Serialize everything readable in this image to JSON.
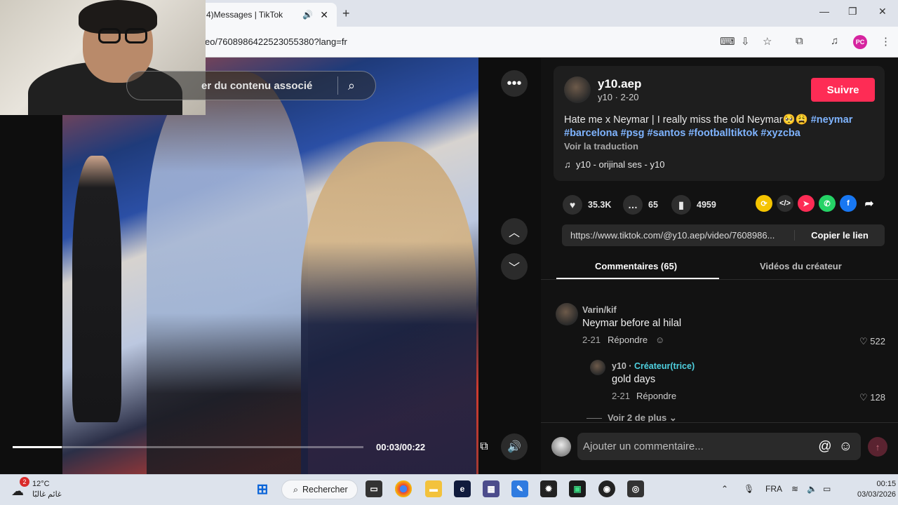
{
  "browser": {
    "tab_title": "4)Messages | TikTok",
    "tab_close": "✕",
    "new_tab": "+",
    "url": "eo/7608986422523055380?lang=fr",
    "profile_initials": "PC",
    "window_controls": [
      "—",
      "❐",
      "✕"
    ]
  },
  "video": {
    "search_placeholder": "er du contenu associé",
    "time": "00:03/00:22",
    "progress_percent": 14
  },
  "post": {
    "username": "y10.aep",
    "subline": "y10 · 2-20",
    "follow_label": "Suivre",
    "description_text": "Hate me x Neymar | I really miss the old Neymar🥺😩 ",
    "hashtags_line1": "#neymar",
    "hashtags_line2": "#barcelona #psg #santos #footballtiktok #xyzcba",
    "translate_label": "Voir la traduction",
    "music": "y10 - orijinal ses - y10",
    "likes": "35.3K",
    "comments": "65",
    "saves": "4959",
    "link_url": "https://www.tiktok.com/@y10.aep/video/7608986...",
    "copy_link_label": "Copier le lien"
  },
  "tabs": {
    "comments_label": "Commentaires (65)",
    "creator_videos_label": "Vidéos du créateur"
  },
  "comments": [
    {
      "author": "Varin/kif",
      "text": "Neymar before al hilal",
      "date": "2-21",
      "reply_label": "Répondre",
      "likes": "522"
    },
    {
      "author": "y10 · ",
      "creator_badge": "Créateur(trice)",
      "text": "gold days",
      "date": "2-21",
      "reply_label": "Répondre",
      "likes": "128"
    }
  ],
  "more_replies_label": "Voir 2 de plus",
  "composer": {
    "placeholder": "Ajouter un commentaire..."
  },
  "taskbar": {
    "weather_temp": "12°C",
    "weather_desc": "غائم غالبًا",
    "weather_badge": "2",
    "search_label": "Rechercher",
    "language": "FRA",
    "time": "00:15",
    "date": "03/03/2026"
  },
  "colors": {
    "accent": "#fe2c55",
    "hashtag": "#7fb4ff",
    "creator_badge": "#4fd1e0"
  }
}
